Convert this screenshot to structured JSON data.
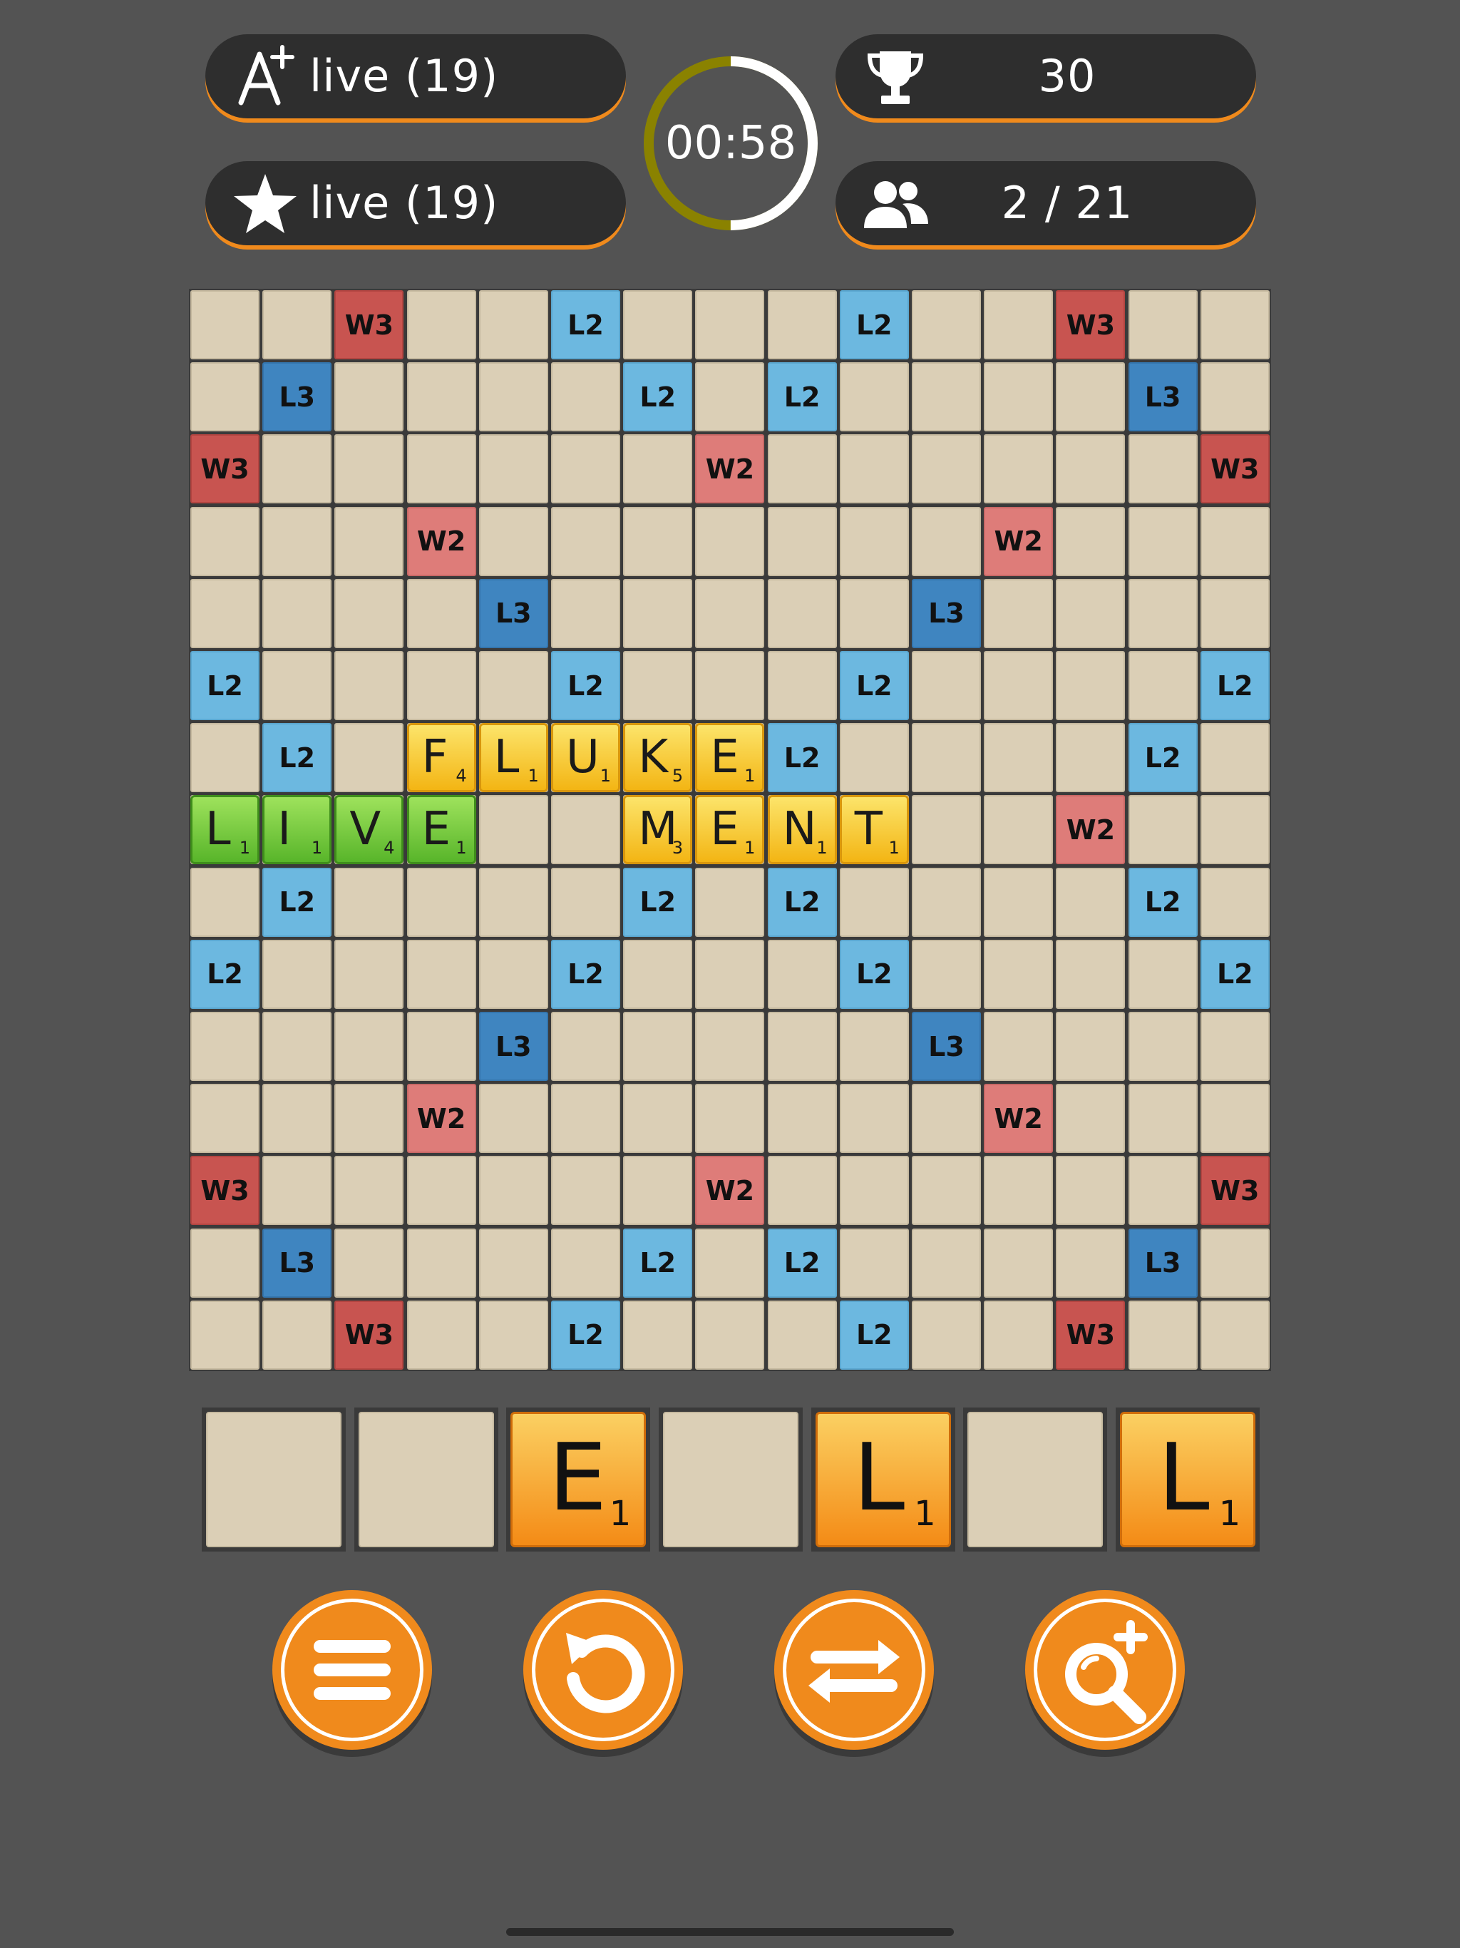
{
  "status": {
    "live_a": {
      "icon": "a-plus-icon",
      "text": "live (19)"
    },
    "live_b": {
      "icon": "star-icon",
      "text": "live (19)"
    },
    "score": {
      "icon": "trophy-icon",
      "text": "30"
    },
    "players": {
      "icon": "players-icon",
      "text": "2 / 21"
    },
    "timer": {
      "text": "00:58",
      "remaining_fraction": 0.5
    }
  },
  "board": {
    "size": 15,
    "premium_cells": [
      {
        "row": 0,
        "col": 2,
        "type": "W3"
      },
      {
        "row": 0,
        "col": 5,
        "type": "L2"
      },
      {
        "row": 0,
        "col": 9,
        "type": "L2"
      },
      {
        "row": 0,
        "col": 12,
        "type": "W3"
      },
      {
        "row": 1,
        "col": 1,
        "type": "L3"
      },
      {
        "row": 1,
        "col": 6,
        "type": "L2"
      },
      {
        "row": 1,
        "col": 8,
        "type": "L2"
      },
      {
        "row": 1,
        "col": 13,
        "type": "L3"
      },
      {
        "row": 2,
        "col": 0,
        "type": "W3"
      },
      {
        "row": 2,
        "col": 7,
        "type": "W2"
      },
      {
        "row": 2,
        "col": 14,
        "type": "W3"
      },
      {
        "row": 3,
        "col": 3,
        "type": "W2"
      },
      {
        "row": 3,
        "col": 11,
        "type": "W2"
      },
      {
        "row": 4,
        "col": 4,
        "type": "L3"
      },
      {
        "row": 4,
        "col": 10,
        "type": "L3"
      },
      {
        "row": 5,
        "col": 0,
        "type": "L2"
      },
      {
        "row": 5,
        "col": 5,
        "type": "L2"
      },
      {
        "row": 5,
        "col": 9,
        "type": "L2"
      },
      {
        "row": 5,
        "col": 14,
        "type": "L2"
      },
      {
        "row": 6,
        "col": 1,
        "type": "L2"
      },
      {
        "row": 6,
        "col": 8,
        "type": "L2"
      },
      {
        "row": 6,
        "col": 13,
        "type": "L2"
      },
      {
        "row": 7,
        "col": 12,
        "type": "W2"
      },
      {
        "row": 8,
        "col": 1,
        "type": "L2"
      },
      {
        "row": 8,
        "col": 6,
        "type": "L2"
      },
      {
        "row": 8,
        "col": 8,
        "type": "L2"
      },
      {
        "row": 8,
        "col": 13,
        "type": "L2"
      },
      {
        "row": 9,
        "col": 0,
        "type": "L2"
      },
      {
        "row": 9,
        "col": 5,
        "type": "L2"
      },
      {
        "row": 9,
        "col": 9,
        "type": "L2"
      },
      {
        "row": 9,
        "col": 14,
        "type": "L2"
      },
      {
        "row": 10,
        "col": 4,
        "type": "L3"
      },
      {
        "row": 10,
        "col": 10,
        "type": "L3"
      },
      {
        "row": 11,
        "col": 3,
        "type": "W2"
      },
      {
        "row": 11,
        "col": 11,
        "type": "W2"
      },
      {
        "row": 12,
        "col": 0,
        "type": "W3"
      },
      {
        "row": 12,
        "col": 7,
        "type": "W2"
      },
      {
        "row": 12,
        "col": 14,
        "type": "W3"
      },
      {
        "row": 13,
        "col": 1,
        "type": "L3"
      },
      {
        "row": 13,
        "col": 6,
        "type": "L2"
      },
      {
        "row": 13,
        "col": 8,
        "type": "L2"
      },
      {
        "row": 13,
        "col": 13,
        "type": "L3"
      },
      {
        "row": 14,
        "col": 2,
        "type": "W3"
      },
      {
        "row": 14,
        "col": 5,
        "type": "L2"
      },
      {
        "row": 14,
        "col": 9,
        "type": "L2"
      },
      {
        "row": 14,
        "col": 12,
        "type": "W3"
      }
    ],
    "tiles": [
      {
        "row": 6,
        "col": 3,
        "letter": "F",
        "points": "4",
        "color": "yellow"
      },
      {
        "row": 6,
        "col": 4,
        "letter": "L",
        "points": "1",
        "color": "yellow"
      },
      {
        "row": 6,
        "col": 5,
        "letter": "U",
        "points": "1",
        "color": "yellow"
      },
      {
        "row": 6,
        "col": 6,
        "letter": "K",
        "points": "5",
        "color": "yellow"
      },
      {
        "row": 6,
        "col": 7,
        "letter": "E",
        "points": "1",
        "color": "yellow"
      },
      {
        "row": 7,
        "col": 0,
        "letter": "L",
        "points": "1",
        "color": "green"
      },
      {
        "row": 7,
        "col": 1,
        "letter": "I",
        "points": "1",
        "color": "green"
      },
      {
        "row": 7,
        "col": 2,
        "letter": "V",
        "points": "4",
        "color": "green"
      },
      {
        "row": 7,
        "col": 3,
        "letter": "E",
        "points": "1",
        "color": "green"
      },
      {
        "row": 7,
        "col": 6,
        "letter": "M",
        "points": "3",
        "color": "yellow"
      },
      {
        "row": 7,
        "col": 7,
        "letter": "E",
        "points": "1",
        "color": "yellow"
      },
      {
        "row": 7,
        "col": 8,
        "letter": "N",
        "points": "1",
        "color": "yellow"
      },
      {
        "row": 7,
        "col": 9,
        "letter": "T",
        "points": "1",
        "color": "yellow"
      }
    ]
  },
  "rack": [
    null,
    null,
    {
      "letter": "E",
      "points": "1"
    },
    null,
    {
      "letter": "L",
      "points": "1"
    },
    null,
    {
      "letter": "L",
      "points": "1"
    }
  ],
  "controls": [
    {
      "id": "menu",
      "icon": "menu-icon"
    },
    {
      "id": "undo",
      "icon": "undo-icon"
    },
    {
      "id": "swap",
      "icon": "swap-icon"
    },
    {
      "id": "hint",
      "icon": "hint-search-icon"
    }
  ],
  "colors": {
    "background": "#535353",
    "accent": "#f08a1c",
    "timer_elapsed": "#8a8200",
    "timer_remaining": "#ffffff"
  }
}
